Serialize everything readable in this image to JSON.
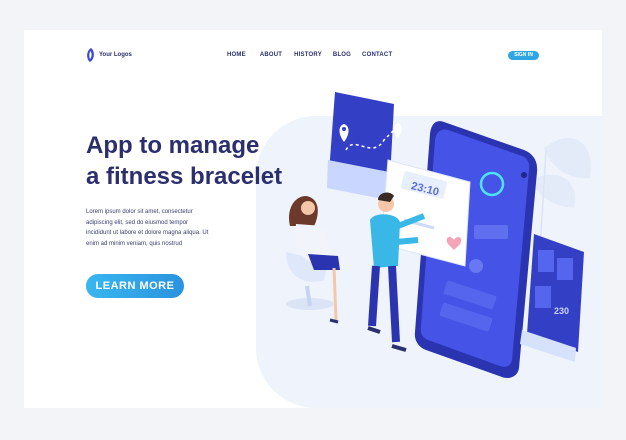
{
  "header": {
    "logo_text": "Your Logos",
    "nav": [
      "HOME",
      "ABOUT",
      "HISTORY",
      "BLOG",
      "CONTACT"
    ],
    "signin_label": "SIGN IN"
  },
  "hero": {
    "title_line1": "App to manage",
    "title_line2": "a fitness bracelet",
    "body_lines": [
      "Lorem ipsum dolor sit amet, consectetur",
      "adipiscing elit, sed do eiusmod tempor",
      "incididunt ut labore et dolore magna aliqua. Ut",
      "enim ad minim veniam, quis nostrud"
    ],
    "cta_label": "LEARN MORE"
  },
  "illustration": {
    "time_card_text": "23:10",
    "side_card_text": "230"
  },
  "colors": {
    "primary_dark": "#2b2f6e",
    "accent_blue": "#2fa6e3",
    "phone_blue": "#3b49d6",
    "background_soft": "#eef3fc"
  },
  "icons": [
    "logo-mark-icon",
    "location-pin-icon",
    "heart-icon",
    "leaf-decoration-icon"
  ]
}
